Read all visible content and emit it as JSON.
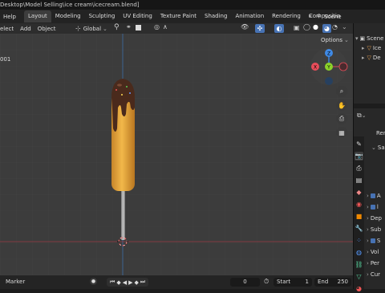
{
  "window": {
    "title": "Desktop\\Model Selling\\ice cream\\icecream.blend]"
  },
  "topbar": {
    "menu": [
      "Help"
    ],
    "tabs": [
      "Layout",
      "Modeling",
      "Sculpting",
      "UV Editing",
      "Texture Paint",
      "Shading",
      "Animation",
      "Rendering",
      "Compositin"
    ],
    "active_tab": "Layout",
    "scene_label": "Scene"
  },
  "viewport_header": {
    "menu": [
      "elect",
      "Add",
      "Object"
    ],
    "transform_orientation": "Global",
    "options_label": "Options"
  },
  "viewport": {
    "info_text": "001",
    "gizmo": {
      "z": "Z",
      "y": "Y",
      "x": "X"
    }
  },
  "outliner": {
    "scene_label": "Scene",
    "rows": [
      "Ice",
      "De"
    ]
  },
  "properties": {
    "tab_label": "Rend",
    "section_label": "Sam",
    "rows": [
      "A",
      "l",
      "Dep",
      "Sub",
      "S",
      "Vol",
      "Per",
      "Cur"
    ]
  },
  "timeline": {
    "marker_label": "Marker",
    "current_frame": "0",
    "start_label": "Start",
    "start_value": "1",
    "end_label": "End",
    "end_value": "250"
  },
  "colors": {
    "accent": "#4772b3",
    "active_tab": "#3d3d3d",
    "gizmo_x": "#e84d5a",
    "gizmo_y": "#8bd22a",
    "gizmo_z": "#3f8ae6",
    "popsicle": "#e4a43a",
    "chocolate": "#4a2a1c"
  }
}
